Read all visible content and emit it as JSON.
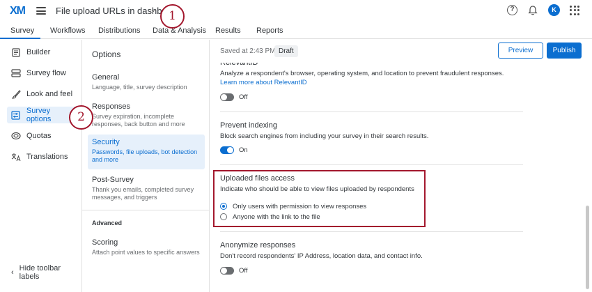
{
  "app": {
    "logo": "XM",
    "project_title": "File upload URLs in dashboard",
    "avatar_initial": "K",
    "accent_color": "#0b6ed0",
    "callout_color": "#a3172d"
  },
  "nav_tabs": [
    "Survey",
    "Workflows",
    "Distributions",
    "Data & Analysis",
    "Results",
    "Reports"
  ],
  "toolbar": {
    "items": [
      "Builder",
      "Survey flow",
      "Look and feel",
      "Survey options",
      "Quotas",
      "Translations"
    ],
    "active": "Survey options",
    "hide_labels": "Hide toolbar labels"
  },
  "options": {
    "title": "Options",
    "items": [
      {
        "title": "General",
        "desc": "Language, title, survey description"
      },
      {
        "title": "Responses",
        "desc": "Survey expiration, incomplete responses, back button and more"
      },
      {
        "title": "Security",
        "desc": "Passwords, file uploads, bot detection and more"
      },
      {
        "title": "Post-Survey",
        "desc": "Thank you emails, completed survey messages, and triggers"
      }
    ],
    "advanced_label": "Advanced",
    "advanced_items": [
      {
        "title": "Scoring",
        "desc": "Attach point values to specific answers"
      }
    ]
  },
  "header": {
    "saved_text": "Saved at 2:43 PM",
    "draft_badge": "Draft",
    "preview_label": "Preview",
    "publish_label": "Publish"
  },
  "sections": {
    "relevant_id": {
      "title": "RelevantID",
      "desc": "Analyze a respondent's browser, operating system, and location to prevent fraudulent responses.",
      "link": "Learn more about RelevantID",
      "state": "Off"
    },
    "prevent_indexing": {
      "title": "Prevent indexing",
      "desc": "Block search engines from including your survey in their search results.",
      "state": "On"
    },
    "uploaded_files": {
      "title": "Uploaded files access",
      "desc": "Indicate who should be able to view files uploaded by respondents",
      "option_1": "Only users with permission to view responses",
      "option_2": "Anyone with the link to the file"
    },
    "anonymize": {
      "title": "Anonymize responses",
      "desc": "Don't record respondents' IP Address, location data, and contact info.",
      "state": "Off"
    }
  },
  "callouts": [
    "1",
    "2"
  ]
}
